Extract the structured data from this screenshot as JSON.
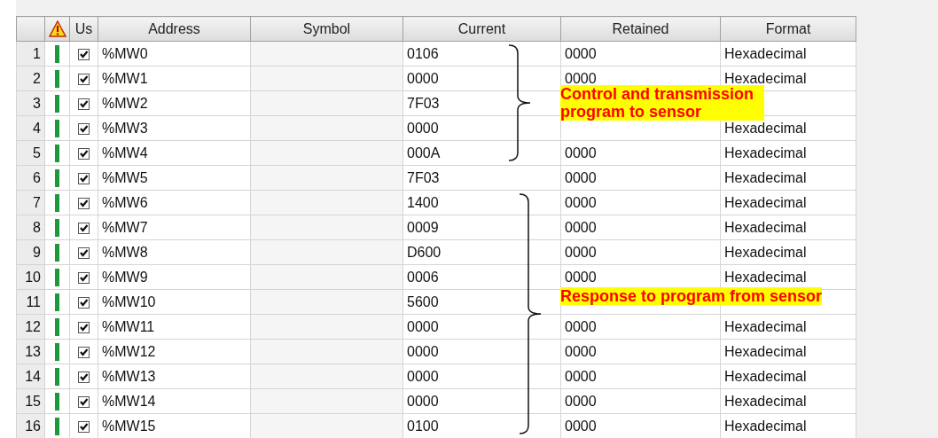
{
  "table": {
    "columns": [
      "Us",
      "Address",
      "Symbol",
      "Current",
      "Retained",
      "Format"
    ],
    "rows": [
      {
        "number": "1",
        "checked": true,
        "address": "%MW0",
        "current": "0106",
        "retained": "0000",
        "format": "Hexadecimal"
      },
      {
        "number": "2",
        "checked": true,
        "address": "%MW1",
        "current": "0000",
        "retained": "0000",
        "format": "Hexadecimal"
      },
      {
        "number": "3",
        "checked": true,
        "address": "%MW2",
        "current": "7F03"
      },
      {
        "number": "4",
        "checked": true,
        "address": "%MW3",
        "current": "0000",
        "format": "Hexadecimal"
      },
      {
        "number": "5",
        "checked": true,
        "address": "%MW4",
        "current": "000A",
        "retained": "0000",
        "format": "Hexadecimal"
      },
      {
        "number": "6",
        "checked": true,
        "address": "%MW5",
        "current": "7F03",
        "retained": "0000",
        "format": "Hexadecimal"
      },
      {
        "number": "7",
        "checked": true,
        "address": "%MW6",
        "current": "1400",
        "retained": "0000",
        "format": "Hexadecimal"
      },
      {
        "number": "8",
        "checked": true,
        "address": "%MW7",
        "current": "0009",
        "retained": "0000",
        "format": "Hexadecimal"
      },
      {
        "number": "9",
        "checked": true,
        "address": "%MW8",
        "current": "D600",
        "retained": "0000",
        "format": "Hexadecimal"
      },
      {
        "number": "10",
        "checked": true,
        "address": "%MW9",
        "current": "0006",
        "retained": "0000",
        "format": "Hexadecimal"
      },
      {
        "number": "11",
        "checked": true,
        "address": "%MW10",
        "current": "5600"
      },
      {
        "number": "12",
        "checked": true,
        "address": "%MW11",
        "current": "0000",
        "retained": "0000",
        "format": "Hexadecimal"
      },
      {
        "number": "13",
        "checked": true,
        "address": "%MW12",
        "current": "0000",
        "retained": "0000",
        "format": "Hexadecimal"
      },
      {
        "number": "14",
        "checked": true,
        "address": "%MW13",
        "current": "0000",
        "retained": "0000",
        "format": "Hexadecimal"
      },
      {
        "number": "15",
        "checked": true,
        "address": "%MW14",
        "current": "0000",
        "retained": "0000",
        "format": "Hexadecimal"
      },
      {
        "number": "16",
        "checked": true,
        "address": "%MW15",
        "current": "0100",
        "retained": "0000",
        "format": "Hexadecimal"
      }
    ]
  },
  "annotations": [
    {
      "text": "Control and transmission program to sensor"
    },
    {
      "text": "Response to program from sensor"
    }
  ]
}
